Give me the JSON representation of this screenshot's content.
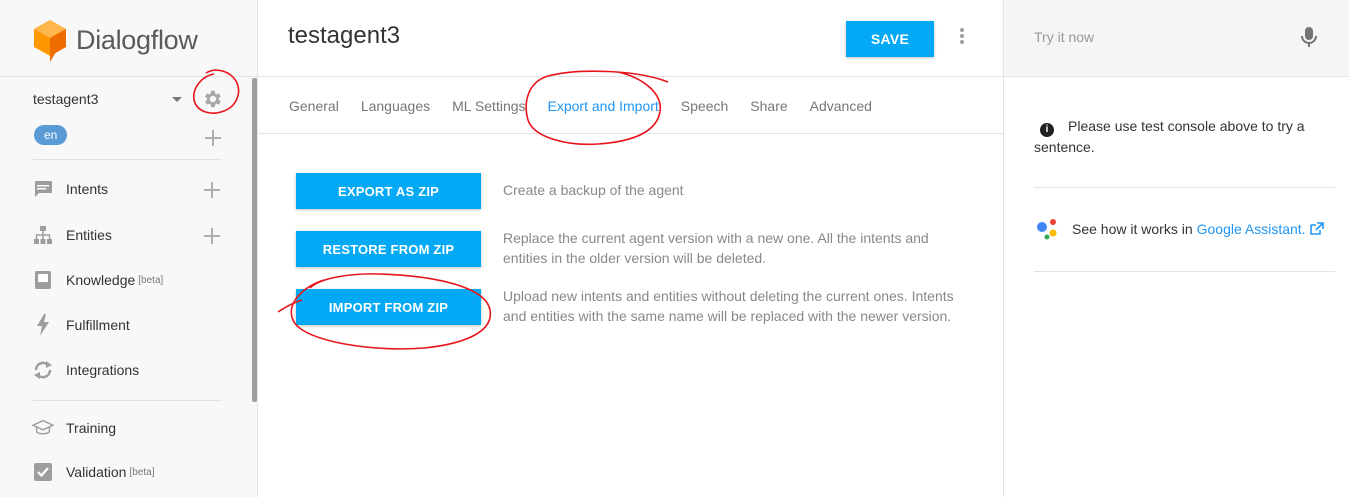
{
  "brand": {
    "name": "Dialogflow"
  },
  "sidebar": {
    "agent_name": "testagent3",
    "language": "en",
    "items": [
      {
        "label": "Intents",
        "icon": "chat-bubble-icon",
        "badge": ""
      },
      {
        "label": "Entities",
        "icon": "hierarchy-icon",
        "badge": ""
      },
      {
        "label": "Knowledge",
        "icon": "book-icon",
        "badge": "[beta]"
      },
      {
        "label": "Fulfillment",
        "icon": "bolt-icon",
        "badge": ""
      },
      {
        "label": "Integrations",
        "icon": "sync-icon",
        "badge": ""
      },
      {
        "label": "Training",
        "icon": "graduation-cap-icon",
        "badge": ""
      },
      {
        "label": "Validation",
        "icon": "checkbox-icon",
        "badge": "[beta]"
      }
    ]
  },
  "header": {
    "title": "testagent3",
    "save_label": "SAVE"
  },
  "tabs": [
    "General",
    "Languages",
    "ML Settings",
    "Export and Import",
    "Speech",
    "Share",
    "Advanced"
  ],
  "active_tab": "Export and Import",
  "actions": [
    {
      "label": "EXPORT AS ZIP",
      "description": "Create a backup of the agent"
    },
    {
      "label": "RESTORE FROM ZIP",
      "description": "Replace the current agent version with a new one. All the intents and entities in the older version will be deleted."
    },
    {
      "label": "IMPORT FROM ZIP",
      "description": "Upload new intents and entities without deleting the current ones. Intents and entities with the same name will be replaced with the newer version."
    }
  ],
  "right_panel": {
    "try_placeholder": "Try it now",
    "info_text": "Please use test console above to try a sentence.",
    "assistant_prefix": "See how it works in",
    "assistant_link": "Google Assistant."
  },
  "colors": {
    "accent": "#03a9f4",
    "active_tab": "#2196f3",
    "annotation": "#e8141c",
    "brand_orange": "#f57c00"
  }
}
